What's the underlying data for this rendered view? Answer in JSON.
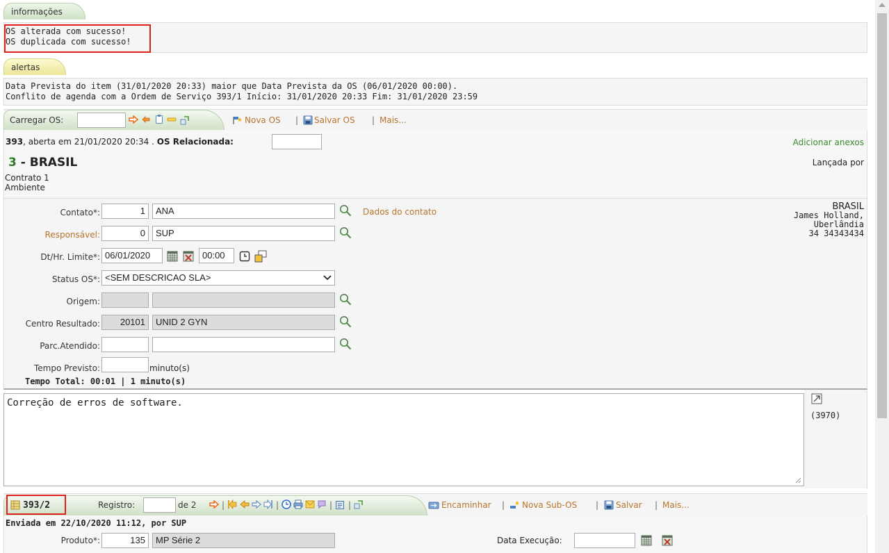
{
  "info": {
    "tab_label": "informações",
    "messages": [
      "OS alterada com sucesso!",
      "OS duplicada com sucesso!"
    ]
  },
  "alerts": {
    "tab_label": "alertas",
    "messages": [
      "Data Prevista do item (31/01/2020 20:33) maior que Data Prevista da OS (06/01/2020 00:00).",
      "Conflito de agenda com a Ordem de Serviço 393/1 Início: 31/01/2020 20:33 Fim: 31/01/2020 23:59"
    ]
  },
  "os_toolbar": {
    "load_label": "Carregar OS:",
    "load_value": "",
    "new_os": "Nova OS",
    "save_os": "Salvar OS",
    "more": "Mais...",
    "separator": "|"
  },
  "os_header": {
    "number": "393",
    "opened_text": ", aberta em 21/01/2020 20:34 . ",
    "related_label": "OS Relacionada:",
    "related_value": "",
    "add_attachments": "Adicionar anexos",
    "client_code": "3",
    "client_name": " - BRASIL",
    "launched_by": "Lançada por",
    "contract": "Contrato 1",
    "environment": "Ambiente"
  },
  "form": {
    "contato": {
      "label": "Contato*:",
      "code": "1",
      "name": "ANA",
      "link": "Dados do contato"
    },
    "responsavel": {
      "label": "Responsável:",
      "code": "0",
      "name": "SUP"
    },
    "limite": {
      "label": "Dt/Hr. Limite*:",
      "date": "06/01/2020",
      "time": "00:00"
    },
    "status": {
      "label": "Status OS*:",
      "value": "<SEM DESCRICAO SLA>"
    },
    "origem": {
      "label": "Origem:",
      "code": "",
      "name": ""
    },
    "centro": {
      "label": "Centro Resultado:",
      "code": "20101",
      "name": "UNID 2 GYN"
    },
    "parc": {
      "label": "Parc.Atendido:",
      "code": "",
      "name": ""
    },
    "tempo": {
      "label": "Tempo Previsto:",
      "value": "",
      "unit": "minuto(s)"
    },
    "tempo_total": "Tempo Total: 00:01 | 1 minuto(s)"
  },
  "contact_card": {
    "name": "BRASIL",
    "person": "James Holland,",
    "city": "Uberlândia",
    "phone": "34 34343434"
  },
  "description": {
    "text": "Correção de erros de software.",
    "count": "(3970)"
  },
  "sub_toolbar": {
    "sub_os": "393/2",
    "registro_label": "Registro:",
    "registro_value": "",
    "of_total": "de 2",
    "forward": "Encaminhar",
    "new_sub_os": "Nova Sub-OS",
    "save": "Salvar",
    "more": "Mais...",
    "separator": "|"
  },
  "sub_os": {
    "sent_text": "Enviada em 22/10/2020 11:12, por SUP",
    "produto_label": "Produto*:",
    "produto_code": "135",
    "produto_name": "MP Série 2",
    "exec_label": "Data Execução:",
    "exec_value": ""
  },
  "colors": {
    "accent_brown": "#b8742d",
    "link_green": "#3c8a2e",
    "highlight_red": "#e01f1f",
    "client_code_green": "#2a7a22"
  }
}
